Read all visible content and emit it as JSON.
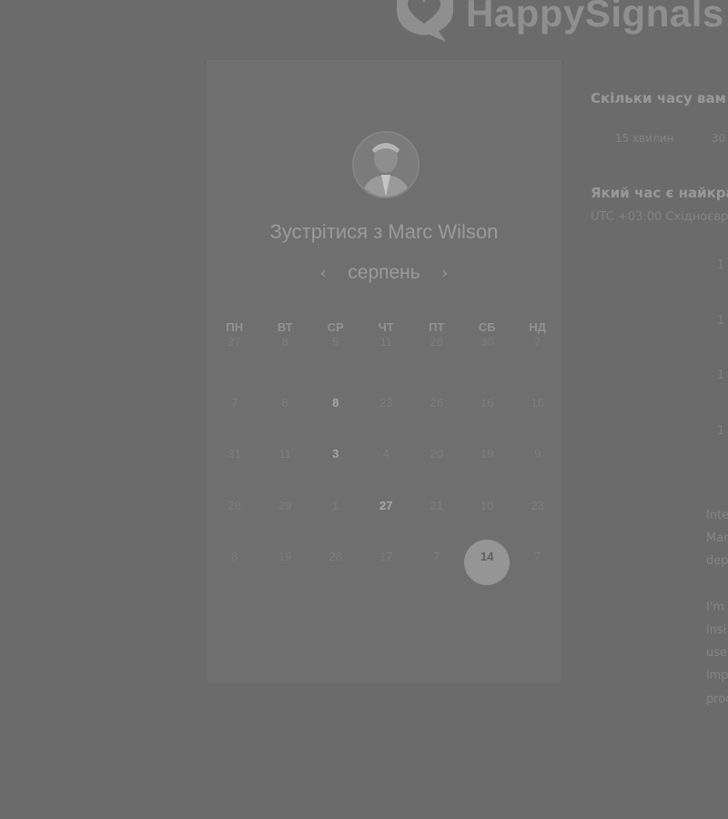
{
  "brand": {
    "name": "HappySignals"
  },
  "host": {
    "title": "Зустрітися з Marc Wilson",
    "avatar_alt": "Marc Wilson"
  },
  "calendar": {
    "month": "серпень",
    "prev_icon": "chevron-left-icon",
    "next_icon": "chevron-right-icon",
    "weekdays": [
      "ПН",
      "ВТ",
      "СР",
      "ЧТ",
      "ПТ",
      "СБ",
      "НД"
    ],
    "weeks": [
      [
        {
          "d": "27",
          "active": false
        },
        {
          "d": "8",
          "active": false
        },
        {
          "d": "5",
          "active": false
        },
        {
          "d": "11",
          "active": false
        },
        {
          "d": "28",
          "active": false
        },
        {
          "d": "30",
          "active": false
        },
        {
          "d": "7",
          "active": false
        }
      ],
      [
        {
          "d": "7",
          "active": false
        },
        {
          "d": "8",
          "active": false
        },
        {
          "d": "8",
          "active": true
        },
        {
          "d": "23",
          "active": false
        },
        {
          "d": "26",
          "active": false
        },
        {
          "d": "16",
          "active": false
        },
        {
          "d": "16",
          "active": false
        }
      ],
      [
        {
          "d": "31",
          "active": false
        },
        {
          "d": "11",
          "active": false
        },
        {
          "d": "3",
          "active": true
        },
        {
          "d": "4",
          "active": false
        },
        {
          "d": "20",
          "active": false
        },
        {
          "d": "19",
          "active": false
        },
        {
          "d": "9",
          "active": false
        }
      ],
      [
        {
          "d": "28",
          "active": false
        },
        {
          "d": "29",
          "active": false
        },
        {
          "d": "1",
          "active": false
        },
        {
          "d": "27",
          "active": true
        },
        {
          "d": "21",
          "active": false
        },
        {
          "d": "10",
          "active": false
        },
        {
          "d": "23",
          "active": false
        }
      ],
      [
        {
          "d": "8",
          "active": false
        },
        {
          "d": "19",
          "active": false
        },
        {
          "d": "28",
          "active": false
        },
        {
          "d": "17",
          "active": false
        },
        {
          "d": "7",
          "active": false
        },
        {
          "d": "14",
          "active": true,
          "selected": true
        },
        {
          "d": "7",
          "active": false
        }
      ]
    ]
  },
  "duration": {
    "question": "Скільки часу вам по",
    "options": [
      "15 хвилин",
      "30"
    ]
  },
  "time": {
    "question": "Який час є найкращ",
    "timezone": "UTC +03:00 Східноєвр",
    "slots": [
      "1",
      "1",
      "1",
      "1"
    ]
  },
  "bio": {
    "lines": [
      "Inte",
      "Mar",
      "dep",
      "",
      "I'm",
      "insi",
      "use",
      "imp",
      "prod"
    ]
  }
}
